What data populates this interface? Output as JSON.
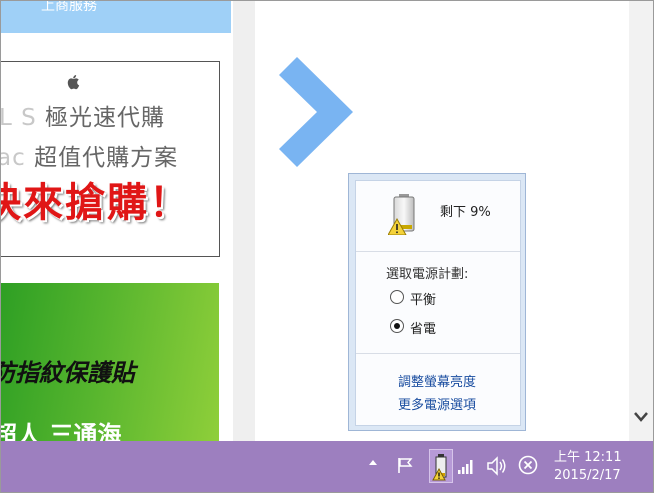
{
  "page": {
    "top_bar_text": "上商服務",
    "ad": {
      "apple_logo": "apple-icon",
      "line1_faded": "L S",
      "line1": "極光速代購",
      "line2_faded": "ac",
      "line2": "超值代購方案",
      "headline": "快來搶購！"
    },
    "green_banner": {
      "text": "防指紋保護貼",
      "text_bottom": "超人 三通海"
    }
  },
  "battery_flyout": {
    "remaining": "剩下 9%",
    "plan_label": "選取電源計劃:",
    "plans": [
      {
        "label": "平衡",
        "selected": false
      },
      {
        "label": "省電",
        "selected": true
      }
    ],
    "links": {
      "brightness": "調整螢幕亮度",
      "more_options": "更多電源選項"
    }
  },
  "taskbar": {
    "color": "#9d7fbf",
    "icons": [
      "show-hidden-icons-icon",
      "action-center-flag-icon",
      "battery-warning-icon",
      "network-signal-icon",
      "volume-icon",
      "close-circle-icon"
    ],
    "time": "上午 12:11",
    "date": "2015/2/17"
  },
  "colors": {
    "chevron": "#79b4f2",
    "link": "#1a4da0",
    "ad_red": "#e01616"
  }
}
